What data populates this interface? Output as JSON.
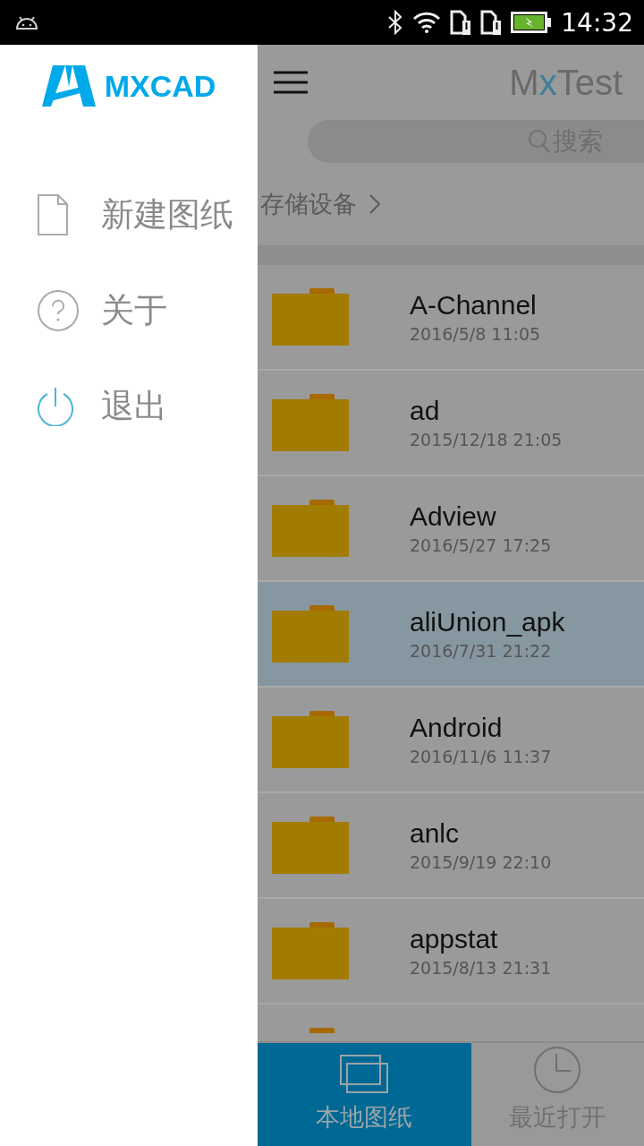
{
  "status_bar": {
    "time": "14:32"
  },
  "drawer": {
    "logo": "MXCAD",
    "items": [
      {
        "kind": "new",
        "label": "新建图纸"
      },
      {
        "kind": "about",
        "label": "关于"
      },
      {
        "kind": "exit",
        "label": "退出"
      }
    ]
  },
  "header": {
    "title": [
      {
        "text": "M",
        "accent": false
      },
      {
        "text": "x",
        "accent": true
      },
      {
        "text": "Test",
        "accent": false
      }
    ]
  },
  "search": {
    "placeholder": "搜索"
  },
  "breadcrumb": "存储设备",
  "files": [
    {
      "name": "A-Channel",
      "date": "2016/5/8  11:05",
      "selected": false
    },
    {
      "name": "ad",
      "date": "2015/12/18  21:05",
      "selected": false
    },
    {
      "name": "Adview",
      "date": "2016/5/27  17:25",
      "selected": false
    },
    {
      "name": "aliUnion_apk",
      "date": "2016/7/31  21:22",
      "selected": true
    },
    {
      "name": "Android",
      "date": "2016/11/6  11:37",
      "selected": false
    },
    {
      "name": "anlc",
      "date": "2015/9/19  22:10",
      "selected": false
    },
    {
      "name": "appstat",
      "date": "2015/8/13  21:31",
      "selected": false
    },
    {
      "kind": "partial"
    }
  ],
  "tabs": [
    {
      "kind": "local",
      "label": "本地图纸",
      "selected": true
    },
    {
      "kind": "recent",
      "label": "最近打开",
      "selected": false
    }
  ]
}
